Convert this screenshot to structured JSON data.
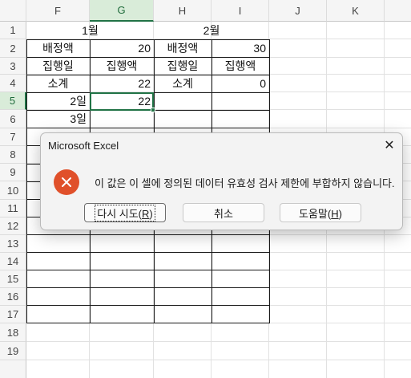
{
  "columns": [
    "F",
    "G",
    "H",
    "I",
    "J",
    "K"
  ],
  "rows": [
    "1",
    "2",
    "3",
    "4",
    "5",
    "6",
    "7",
    "8",
    "9",
    "10",
    "11",
    "12",
    "13",
    "14",
    "15",
    "16",
    "17",
    "18",
    "19"
  ],
  "selected_column": "G",
  "selected_row": "5",
  "cells": {
    "month1": "1월",
    "month2": "2월",
    "r2_f": "배정액",
    "r2_g": "20",
    "r2_h": "배정액",
    "r2_i": "30",
    "r3_f": "집행일",
    "r3_g": "집행액",
    "r3_h": "집행일",
    "r3_i": "집행액",
    "r4_f": "소계",
    "r4_g": "22",
    "r4_h": "소계",
    "r4_i": "0",
    "r5_f": "2일",
    "r5_g": "22",
    "r6_f": "3일"
  },
  "dialog": {
    "title": "Microsoft Excel",
    "close_glyph": "✕",
    "message": "이 값은 이 셀에 정의된 데이터 유효성 검사 제한에 부합하지 않습니다.",
    "icon": "error-icon",
    "icon_color": "#e0502a",
    "buttons": {
      "retry": {
        "label": "다시 시도(",
        "key": "R",
        "suffix": ")"
      },
      "cancel": {
        "label": "취소"
      },
      "help": {
        "label": "도움말(",
        "key": "H",
        "suffix": ")"
      }
    }
  },
  "colors": {
    "accent": "#217346",
    "header_bg": "#f5f5f5",
    "gridline": "#e1e1e1"
  }
}
